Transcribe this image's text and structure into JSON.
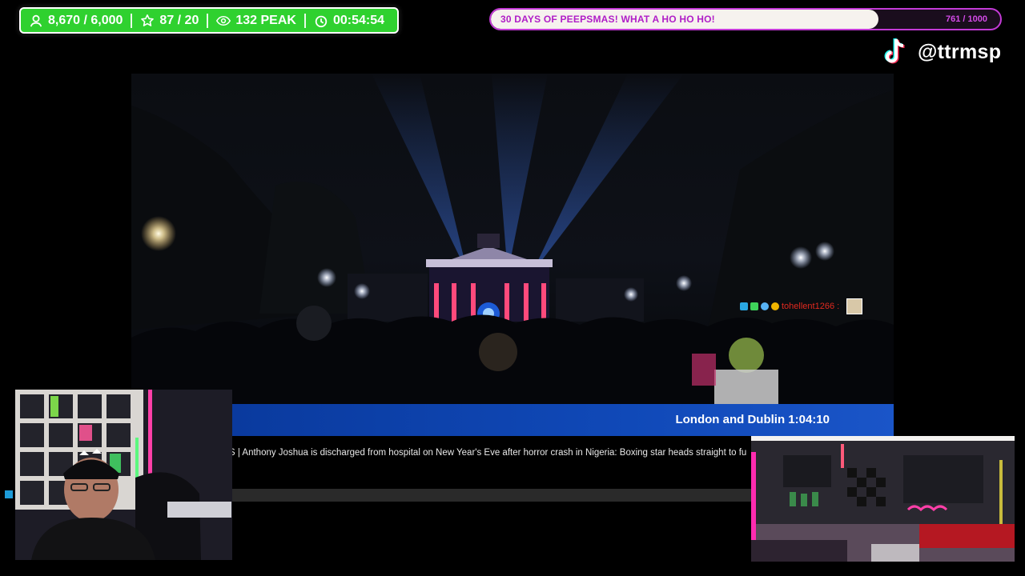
{
  "stats": {
    "followers": "8,670 / 6,000",
    "subs": "87 / 20",
    "peak_viewers": "132 PEAK",
    "uptime": "00:54:54"
  },
  "goal": {
    "title": "30 DAYS OF PEEPSMAS! WHAT A HO HO HO!",
    "progress_text": "761 / 1000",
    "progress_fraction": 0.761,
    "accent_color": "#c33ad6"
  },
  "social": {
    "platform_icon": "tiktok-icon",
    "handle": "@ttrmsp"
  },
  "broadcast": {
    "chat_user": "tohellent1266",
    "chat_sep": ":",
    "location_clock": "London and Dublin  1:04:10",
    "ticker_text": "S | Anthony Joshua is discharged from hospital on New Year's Eve after horror crash in Nigeria: Boxing star heads straight to fu",
    "banner_color": "#1049b8"
  },
  "colors": {
    "stats_bg": "#2fd12f"
  }
}
